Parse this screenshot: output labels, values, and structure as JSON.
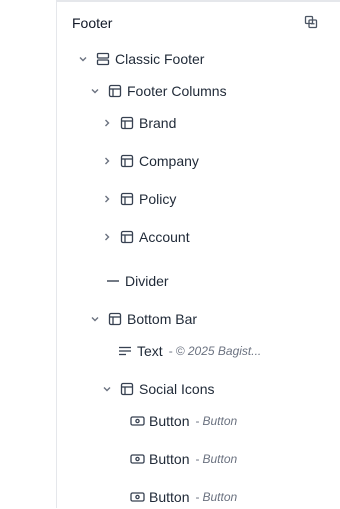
{
  "panel": {
    "title": "Footer"
  },
  "tree": {
    "root": {
      "label": "Classic Footer"
    },
    "columns": {
      "label": "Footer Columns"
    },
    "brand": {
      "label": "Brand"
    },
    "company": {
      "label": "Company"
    },
    "policy": {
      "label": "Policy"
    },
    "account": {
      "label": "Account"
    },
    "divider": {
      "label": "Divider"
    },
    "bottom_bar": {
      "label": "Bottom Bar"
    },
    "text": {
      "label": "Text",
      "sub": "© 2025 Bagist..."
    },
    "social_icons": {
      "label": "Social Icons"
    },
    "buttons": [
      {
        "label": "Button",
        "sub": "Button"
      },
      {
        "label": "Button",
        "sub": "Button"
      },
      {
        "label": "Button",
        "sub": "Button"
      }
    ]
  },
  "icons": {
    "copy": "copy-icon",
    "expanded": "chevron-down-icon",
    "collapsed": "chevron-right-icon",
    "section": "section-icon",
    "layout": "layout-icon",
    "divider": "divider-icon",
    "text": "text-icon",
    "button": "button-icon"
  },
  "colors": {
    "text": "#1f2937",
    "muted": "#6b7280",
    "border": "#e5e7eb"
  }
}
